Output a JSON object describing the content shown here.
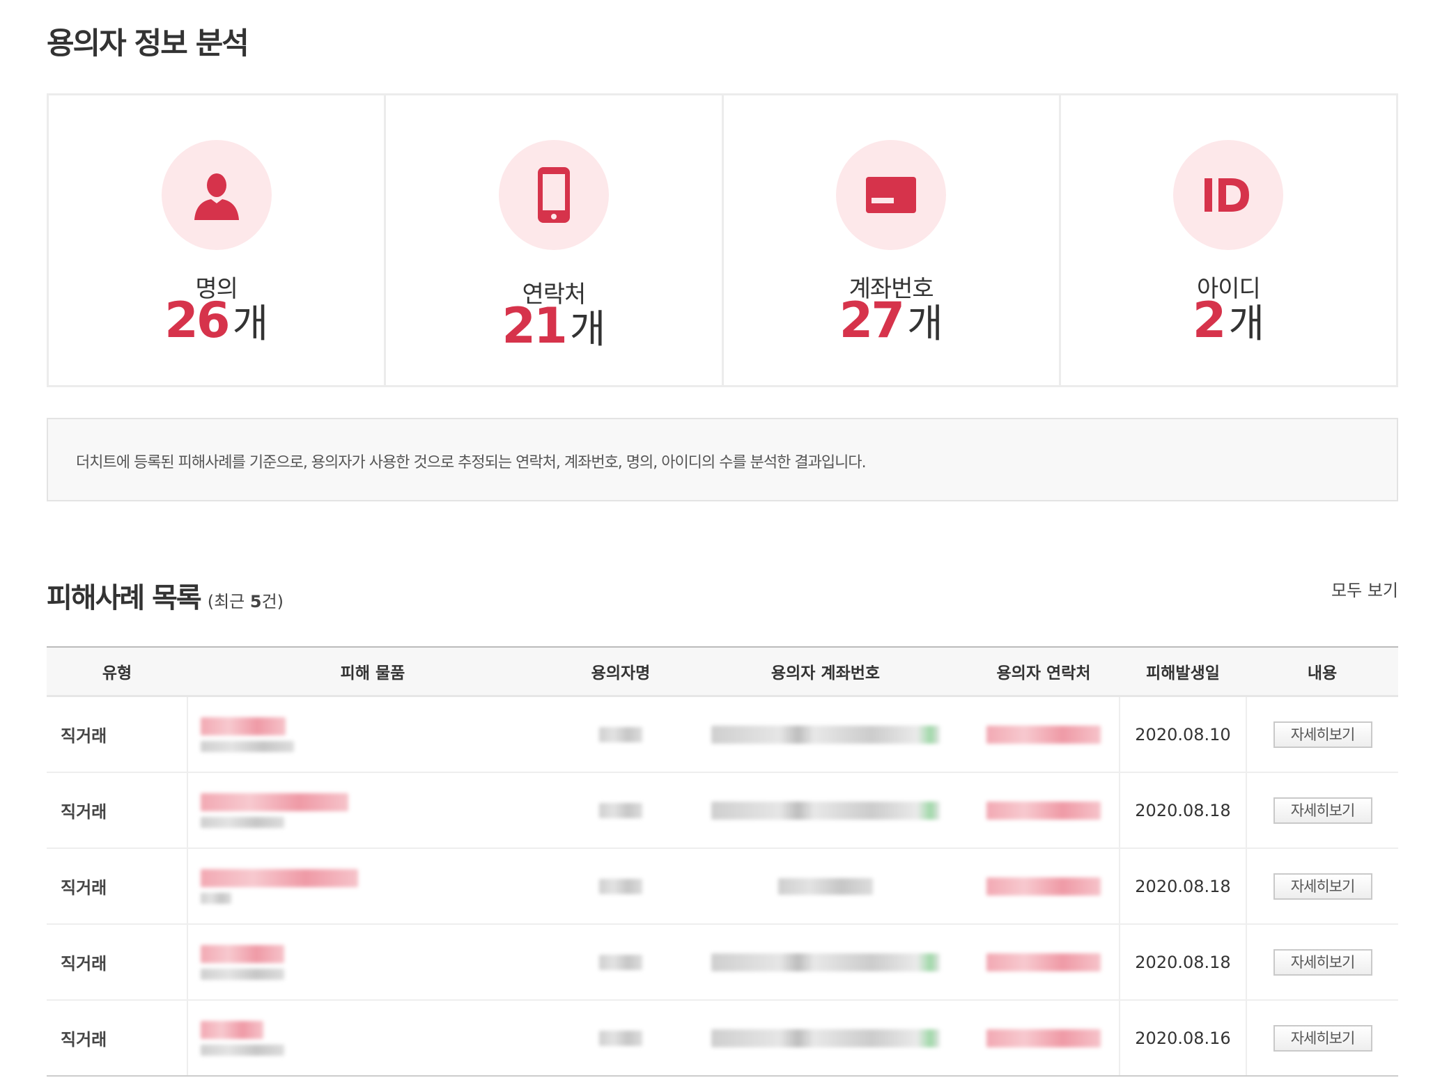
{
  "page": {
    "title": "용의자 정보 분석"
  },
  "stats": [
    {
      "label": "명의",
      "value": "26",
      "unit": "개",
      "icon": "person-icon"
    },
    {
      "label": "연락처",
      "value": "21",
      "unit": "개",
      "icon": "phone-icon"
    },
    {
      "label": "계좌번호",
      "value": "27",
      "unit": "개",
      "icon": "card-icon"
    },
    {
      "label": "아이디",
      "value": "2",
      "unit": "개",
      "icon": "id-icon"
    }
  ],
  "notice": "더치트에 등록된 피해사례를 기준으로, 용의자가 사용한 것으로 추정되는 연락처, 계좌번호, 명의, 아이디의 수를 분석한 결과입니다.",
  "list": {
    "title": "피해사례 목록",
    "sub_prefix": "(최근 ",
    "sub_count": "5",
    "sub_suffix": "건)",
    "view_all": "모두 보기",
    "columns": [
      "유형",
      "피해 물품",
      "용의자명",
      "용의자 계좌번호",
      "용의자 연락처",
      "피해발생일",
      "내용"
    ],
    "rows": [
      {
        "type": "직거래",
        "date": "2020.08.10",
        "action": "자세히보기"
      },
      {
        "type": "직거래",
        "date": "2020.08.18",
        "action": "자세히보기"
      },
      {
        "type": "직거래",
        "date": "2020.08.18",
        "action": "자세히보기"
      },
      {
        "type": "직거래",
        "date": "2020.08.18",
        "action": "자세히보기"
      },
      {
        "type": "직거래",
        "date": "2020.08.16",
        "action": "자세히보기"
      }
    ]
  },
  "colors": {
    "accent": "#d6334b",
    "icon_bg": "#fde8ea"
  }
}
